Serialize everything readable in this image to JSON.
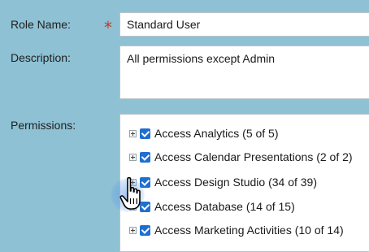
{
  "form": {
    "role_name_label": "Role Name:",
    "required_marker": "*",
    "role_name_value": "Standard User",
    "description_label": "Description:",
    "description_value": "All permissions except Admin",
    "permissions_label": "Permissions:"
  },
  "permissions": [
    {
      "label": "Access Analytics (5 of 5)",
      "checked": true
    },
    {
      "label": "Access Calendar Presentations (2 of 2)",
      "checked": true
    },
    {
      "label": "Access Design Studio (34 of 39)",
      "checked": true
    },
    {
      "label": "Access Database (14 of 15)",
      "checked": true
    },
    {
      "label": "Access Marketing Activities (10 of 14)",
      "checked": true
    }
  ],
  "icons": {
    "expander": "plus-square-icon",
    "checkbox": "checkbox-checked-icon",
    "cursor": "hand-pointer-icon"
  },
  "colors": {
    "background": "#8ec1d4",
    "checkbox": "#1f6fd1",
    "required": "#c0392b"
  }
}
